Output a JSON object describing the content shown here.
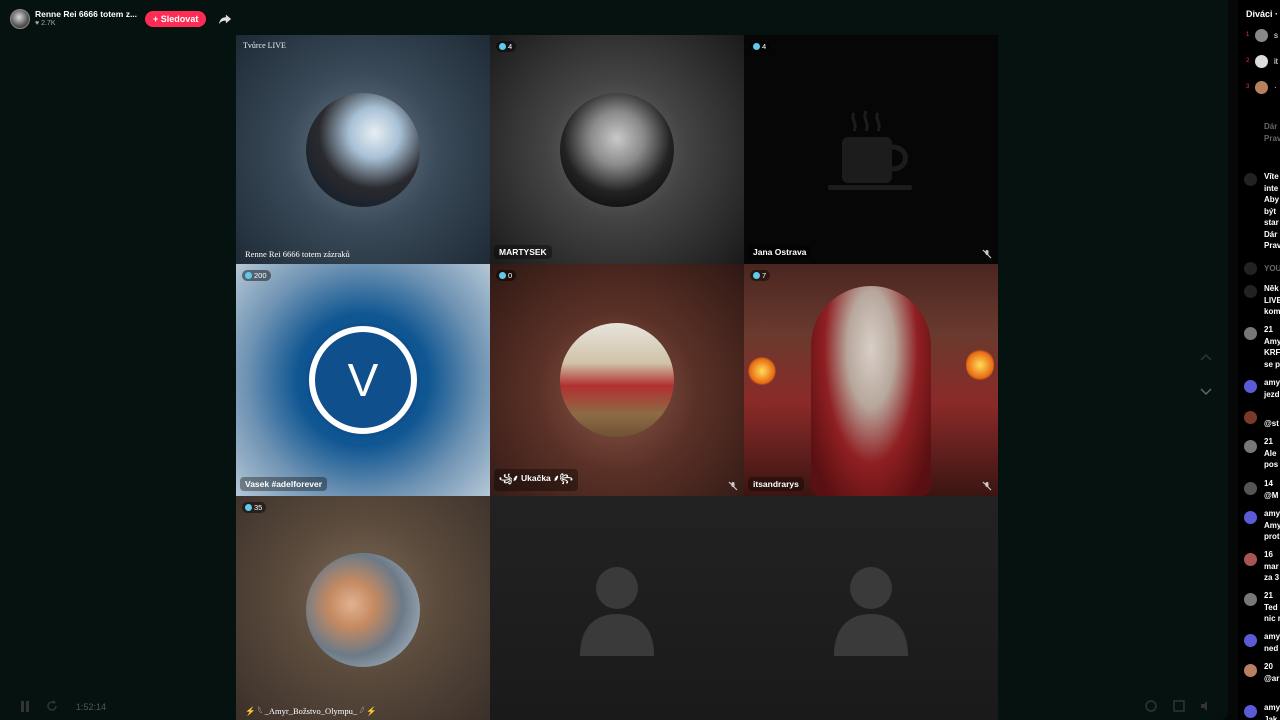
{
  "host": {
    "name": "Renne Rei 6666 totem z...",
    "likes": "♥ 2.7K",
    "follow_label": "+ Sledovat"
  },
  "grid": [
    {
      "top_text": "Tvůrce LIVE",
      "name": "Renne Rei 6666 totem zázraků"
    },
    {
      "count": "4",
      "name": "MARTYSEK"
    },
    {
      "count": "4",
      "name": "Jana Ostrava"
    },
    {
      "count": "200",
      "name": "Vasek #adelforever",
      "initial": "V"
    },
    {
      "count": "0",
      "name": "꧁⸙ Ukačka ⸙꧂"
    },
    {
      "count": "7",
      "name": "itsandrarys"
    },
    {
      "count": "35",
      "name": "⚡ 𓆩 _Amyr_Božstvo_Olympu_ 𓆪 ⚡"
    },
    {},
    {}
  ],
  "controls": {
    "time": "1:52:14"
  },
  "sidebar": {
    "title": "Diváci ·",
    "ranks": [
      "1",
      "2",
      "3"
    ],
    "viewer_snippets": [
      "s",
      "it",
      "·"
    ],
    "chat": [
      "Dár\nPrav",
      "Vīte\ninte\nAby\nbýt\nstar\nDár\nPrav",
      "YOU",
      "Něk\nLIVE\nkom",
      "21\nAmy\nKRF\nse p",
      "amy\njezd",
      "@st",
      "21\nAle\npos",
      "14\n@M",
      "amy\nAmy\nprot",
      "16\nmar\nza 3",
      "21\nTed\nnic r",
      "amy\nned",
      "20\n@ar",
      "amy\nJak"
    ]
  }
}
